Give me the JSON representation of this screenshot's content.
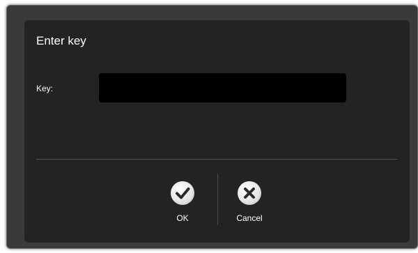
{
  "dialog": {
    "title": "Enter key",
    "key_label": "Key:",
    "key_value": "",
    "ok_label": "OK",
    "cancel_label": "Cancel"
  },
  "icons": {
    "ok": "checkmark-icon",
    "cancel": "close-icon"
  },
  "colors": {
    "outer_frame": "#3a3a3a",
    "panel": "#232323",
    "input": "#000000",
    "text": "#ffffff"
  }
}
